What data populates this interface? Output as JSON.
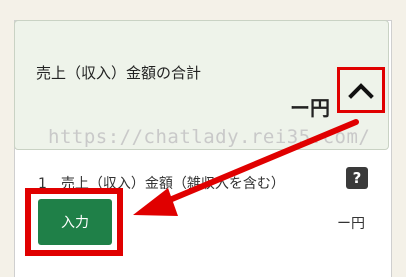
{
  "summary": {
    "title": "売上（収入）金額の合計",
    "amount": "ー円"
  },
  "watermark": "https://chatlady.rei35.com/",
  "item": {
    "label": "1　売上（収入）金額（雑収入を含む）",
    "help": "?",
    "button_label": "入力",
    "amount": "ー円"
  },
  "colors": {
    "highlight": "#e00000",
    "button": "#1f8048"
  },
  "icons": {
    "toggle": "chevron-up-icon",
    "help": "help-icon",
    "annotation": "red-arrow"
  }
}
